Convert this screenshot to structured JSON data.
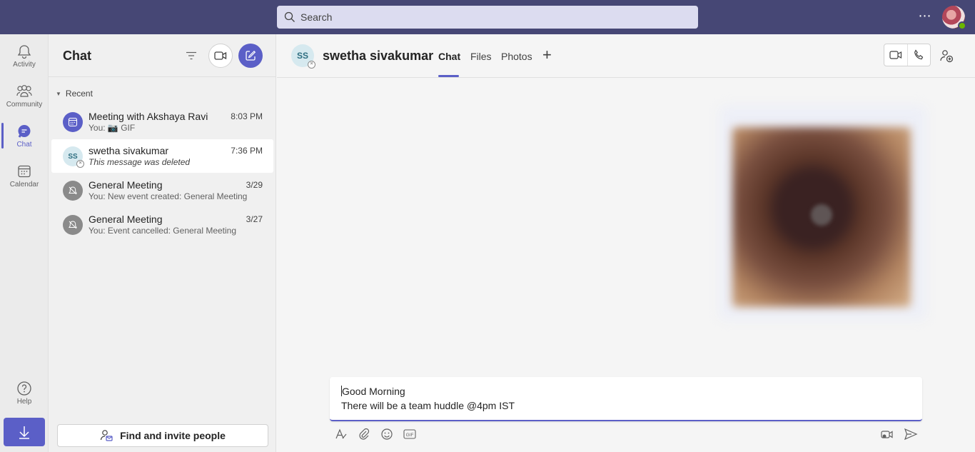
{
  "topbar": {
    "search_placeholder": "Search",
    "more_label": "⋯"
  },
  "rail": {
    "items": [
      {
        "label": "Activity",
        "icon": "bell-icon"
      },
      {
        "label": "Community",
        "icon": "community-icon"
      },
      {
        "label": "Chat",
        "icon": "chat-icon"
      },
      {
        "label": "Calendar",
        "icon": "calendar-icon"
      }
    ],
    "help_label": "Help"
  },
  "chatlist": {
    "title": "Chat",
    "section_label": "Recent",
    "find_label": "Find and invite people",
    "chats": [
      {
        "name": "Meeting with Akshaya Ravi",
        "time": "8:03 PM",
        "preview": "You: 📷 GIF"
      },
      {
        "name": "swetha sivakumar",
        "time": "7:36 PM",
        "preview": "This message was deleted",
        "initials": "SS"
      },
      {
        "name": "General Meeting",
        "time": "3/29",
        "preview": "You: New event created: General Meeting"
      },
      {
        "name": "General Meeting",
        "time": "3/27",
        "preview": "You: Event cancelled: General Meeting"
      }
    ]
  },
  "conversation": {
    "initials": "SS",
    "name": "swetha sivakumar",
    "tabs": [
      "Chat",
      "Files",
      "Photos"
    ],
    "add_tab": "+",
    "compose": {
      "line1": "Good Morning",
      "line2": "There will be a team huddle @4pm IST"
    }
  },
  "colors": {
    "brand": "#5b5fc7",
    "topbar": "#464775",
    "presence_available": "#6bb700"
  }
}
